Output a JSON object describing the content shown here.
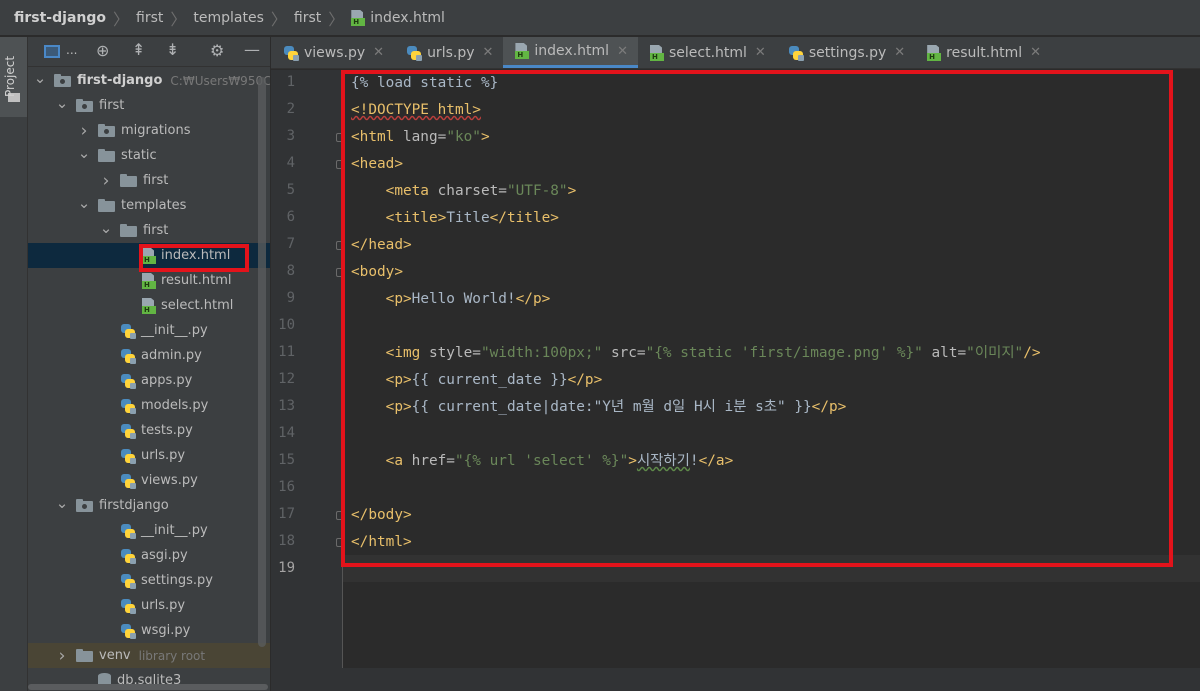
{
  "breadcrumb": [
    {
      "label": "first-django",
      "bold": true
    },
    {
      "label": "first"
    },
    {
      "label": "templates"
    },
    {
      "label": "first"
    },
    {
      "label": "index.html",
      "icon": "html-file-icon"
    }
  ],
  "sidebar": {
    "project_tab": "Project"
  },
  "project": {
    "toolbar_label": "...",
    "tree": [
      {
        "label": "first-django",
        "bold": true,
        "hint": "C:₩Users₩950C",
        "indent": 0,
        "arrow": "down",
        "icon": "folder-module-icon"
      },
      {
        "label": "first",
        "indent": 1,
        "arrow": "down",
        "icon": "folder-module-icon"
      },
      {
        "label": "migrations",
        "indent": 2,
        "arrow": "right",
        "icon": "folder-module-icon"
      },
      {
        "label": "static",
        "indent": 2,
        "arrow": "down",
        "icon": "folder-icon"
      },
      {
        "label": "first",
        "indent": 3,
        "arrow": "right",
        "icon": "folder-icon"
      },
      {
        "label": "templates",
        "indent": 2,
        "arrow": "down",
        "icon": "folder-icon"
      },
      {
        "label": "first",
        "indent": 3,
        "arrow": "down",
        "icon": "folder-icon"
      },
      {
        "label": "index.html",
        "indent": 4,
        "icon": "html-file-icon",
        "selected": true
      },
      {
        "label": "result.html",
        "indent": 4,
        "icon": "html-file-icon"
      },
      {
        "label": "select.html",
        "indent": 4,
        "icon": "html-file-icon"
      },
      {
        "label": "__init__.py",
        "indent": 3,
        "icon": "python-file-icon"
      },
      {
        "label": "admin.py",
        "indent": 3,
        "icon": "python-file-icon"
      },
      {
        "label": "apps.py",
        "indent": 3,
        "icon": "python-file-icon"
      },
      {
        "label": "models.py",
        "indent": 3,
        "icon": "python-file-icon"
      },
      {
        "label": "tests.py",
        "indent": 3,
        "icon": "python-file-icon"
      },
      {
        "label": "urls.py",
        "indent": 3,
        "icon": "python-file-icon"
      },
      {
        "label": "views.py",
        "indent": 3,
        "icon": "python-file-icon"
      },
      {
        "label": "firstdjango",
        "indent": 1,
        "arrow": "down",
        "icon": "folder-module-icon"
      },
      {
        "label": "__init__.py",
        "indent": 3,
        "icon": "python-file-icon"
      },
      {
        "label": "asgi.py",
        "indent": 3,
        "icon": "python-file-icon"
      },
      {
        "label": "settings.py",
        "indent": 3,
        "icon": "python-file-icon"
      },
      {
        "label": "urls.py",
        "indent": 3,
        "icon": "python-file-icon"
      },
      {
        "label": "wsgi.py",
        "indent": 3,
        "icon": "python-file-icon"
      },
      {
        "label": "venv",
        "hint": "library root",
        "indent": 1,
        "arrow": "right",
        "icon": "folder-icon",
        "excluded": true
      },
      {
        "label": "db.sqlite3",
        "indent": 2,
        "icon": "database-file-icon"
      }
    ]
  },
  "tabs": [
    {
      "label": "views.py",
      "icon": "python-file-icon"
    },
    {
      "label": "urls.py",
      "icon": "python-file-icon"
    },
    {
      "label": "index.html",
      "icon": "html-file-icon",
      "active": true
    },
    {
      "label": "select.html",
      "icon": "html-file-icon"
    },
    {
      "label": "settings.py",
      "icon": "python-file-icon"
    },
    {
      "label": "result.html",
      "icon": "html-file-icon"
    }
  ],
  "editor": {
    "current_line": 19,
    "line_numbers": [
      "1",
      "2",
      "3",
      "4",
      "5",
      "6",
      "7",
      "8",
      "9",
      "10",
      "11",
      "12",
      "13",
      "14",
      "15",
      "16",
      "17",
      "18",
      "19"
    ],
    "code": [
      [
        [
          "dj",
          "{% load static %}"
        ]
      ],
      [
        [
          "t",
          "<!DOCTYPE html>"
        ]
      ],
      [
        [
          "t",
          "<html "
        ],
        [
          "an",
          "lang="
        ],
        [
          "av",
          "\"ko\""
        ],
        [
          "t",
          ">"
        ]
      ],
      [
        [
          "t",
          "<head>"
        ]
      ],
      [
        [
          "tx",
          "    "
        ],
        [
          "t",
          "<meta "
        ],
        [
          "an",
          "charset="
        ],
        [
          "av",
          "\"UTF-8\""
        ],
        [
          "t",
          ">"
        ]
      ],
      [
        [
          "tx",
          "    "
        ],
        [
          "t",
          "<title>"
        ],
        [
          "tx",
          "Title"
        ],
        [
          "t",
          "</title>"
        ]
      ],
      [
        [
          "t",
          "</head>"
        ]
      ],
      [
        [
          "t",
          "<body>"
        ]
      ],
      [
        [
          "tx",
          "    "
        ],
        [
          "t",
          "<p>"
        ],
        [
          "tx",
          "Hello World!"
        ],
        [
          "t",
          "</p>"
        ]
      ],
      [],
      [
        [
          "tx",
          "    "
        ],
        [
          "t",
          "<img "
        ],
        [
          "an",
          "style="
        ],
        [
          "av",
          "\"width:100px;\" "
        ],
        [
          "an",
          "src="
        ],
        [
          "av",
          "\"{% static 'first/image.png' %}\" "
        ],
        [
          "an",
          "alt="
        ],
        [
          "av",
          "\"이미지\""
        ],
        [
          "t",
          "/>"
        ]
      ],
      [
        [
          "tx",
          "    "
        ],
        [
          "t",
          "<p>"
        ],
        [
          "tx",
          "{{ current_date }}"
        ],
        [
          "t",
          "</p>"
        ]
      ],
      [
        [
          "tx",
          "    "
        ],
        [
          "t",
          "<p>"
        ],
        [
          "tx",
          "{{ current_date|date:\"Y년 m월 d일 H시 i분 s초\" }}"
        ],
        [
          "t",
          "</p>"
        ]
      ],
      [],
      [
        [
          "tx",
          "    "
        ],
        [
          "t",
          "<a "
        ],
        [
          "an",
          "href="
        ],
        [
          "av",
          "\"{% url 'select' %}\""
        ],
        [
          "t",
          ">"
        ],
        [
          "wg",
          "시작하기"
        ],
        [
          "tx",
          "!"
        ],
        [
          "t",
          "</a>"
        ]
      ],
      [],
      [
        [
          "t",
          "</body>"
        ]
      ],
      [
        [
          "t",
          "</html>"
        ]
      ],
      []
    ]
  },
  "colors": {
    "highlight": "#e3131b",
    "tag": "#e8bf6a",
    "attr_value": "#6a8759",
    "selection": "#0d293e"
  }
}
